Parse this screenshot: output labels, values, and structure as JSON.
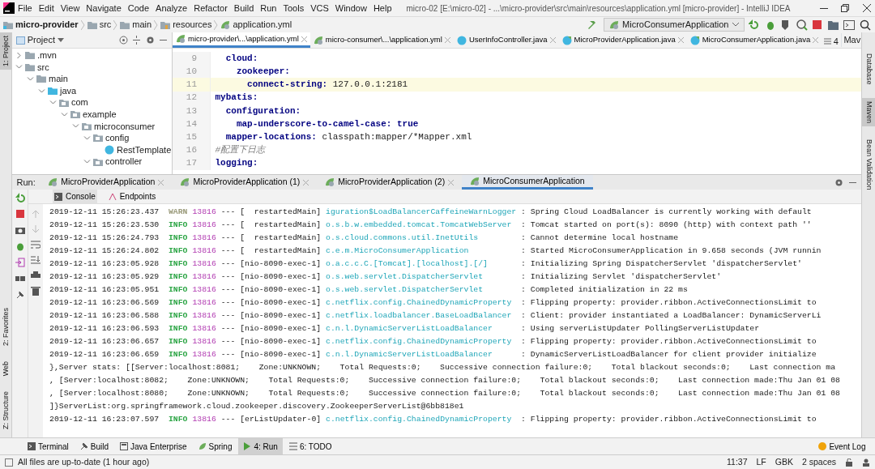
{
  "window": {
    "title": "micro-02 [E:\\micro-02] - ...\\micro-provider\\src\\main\\resources\\application.yml [micro-provider] - IntelliJ IDEA"
  },
  "menu": [
    "File",
    "Edit",
    "View",
    "Navigate",
    "Code",
    "Analyze",
    "Refactor",
    "Build",
    "Run",
    "Tools",
    "VCS",
    "Window",
    "Help"
  ],
  "breadcrumb": [
    {
      "label": "micro-provider",
      "kind": "module"
    },
    {
      "label": "src",
      "kind": "folder"
    },
    {
      "label": "main",
      "kind": "folder"
    },
    {
      "label": "resources",
      "kind": "resources"
    },
    {
      "label": "application.yml",
      "kind": "yaml"
    }
  ],
  "run_config": "MicroConsumerApplication",
  "left_stripe": [
    {
      "label": "1: Project",
      "selected": true
    },
    {
      "label": "2: Favorites",
      "selected": false
    },
    {
      "label": "Web",
      "selected": false
    },
    {
      "label": "Z: Structure",
      "selected": false
    }
  ],
  "right_stripe": [
    {
      "label": "Database",
      "selected": false
    },
    {
      "label": "Maven",
      "selected": true
    },
    {
      "label": "Bean Validation",
      "selected": false
    }
  ],
  "project": {
    "title": "Project",
    "tree": [
      {
        "label": ".mvn",
        "kind": "folder",
        "expanded": false
      },
      {
        "label": "src",
        "kind": "folder",
        "expanded": true,
        "children": [
          {
            "label": "main",
            "kind": "folder",
            "expanded": true,
            "children": [
              {
                "label": "java",
                "kind": "source",
                "expanded": true,
                "children": [
                  {
                    "label": "com",
                    "kind": "package",
                    "expanded": true,
                    "children": [
                      {
                        "label": "example",
                        "kind": "package",
                        "expanded": true,
                        "children": [
                          {
                            "label": "microconsumer",
                            "kind": "package",
                            "expanded": true,
                            "children": [
                              {
                                "label": "config",
                                "kind": "package",
                                "expanded": true,
                                "children": [
                                  {
                                    "label": "RestTemplate",
                                    "kind": "class"
                                  }
                                ]
                              },
                              {
                                "label": "controller",
                                "kind": "package",
                                "expanded": true
                              }
                            ]
                          }
                        ]
                      }
                    ]
                  }
                ]
              }
            ]
          }
        ]
      }
    ]
  },
  "editor_tabs": [
    {
      "label": "micro-provider\\...\\application.yml",
      "kind": "yaml",
      "selected": true
    },
    {
      "label": "micro-consumer\\...\\application.yml",
      "kind": "yaml",
      "selected": false
    },
    {
      "label": "UserInfoController.java",
      "kind": "class",
      "selected": false
    },
    {
      "label": "MicroProviderApplication.java",
      "kind": "app",
      "selected": false
    },
    {
      "label": "MicroConsumerApplication.java",
      "kind": "app",
      "selected": false
    }
  ],
  "editor_overflow": "4",
  "maven_tab": "Mav",
  "code": [
    {
      "no": "9",
      "key": "  cloud:",
      "current": false
    },
    {
      "no": "10",
      "key": "    zookeeper:",
      "current": false
    },
    {
      "no": "11",
      "key": "      connect-string:",
      "value": " 127.0.0.1:2181",
      "current": true
    },
    {
      "no": "12",
      "key": "mybatis:",
      "current": false
    },
    {
      "no": "13",
      "key": "  configuration:",
      "current": false
    },
    {
      "no": "14",
      "key": "    map-underscore-to-camel-case:",
      "value": " true",
      "kind": "bool",
      "current": false
    },
    {
      "no": "15",
      "key": "  mapper-locations:",
      "value": " classpath:mapper/*Mapper.xml",
      "current": false
    },
    {
      "no": "16",
      "comment": "#配置下日志",
      "current": false
    },
    {
      "no": "17",
      "key": "logging:",
      "current": false
    }
  ],
  "run": {
    "label": "Run:",
    "tabs": [
      {
        "label": "MicroProviderApplication",
        "selected": false
      },
      {
        "label": "MicroProviderApplication (1)",
        "selected": false
      },
      {
        "label": "MicroProviderApplication (2)",
        "selected": false
      },
      {
        "label": "MicroConsumerApplication",
        "selected": true
      }
    ],
    "console_tabs": [
      {
        "label": "Console",
        "selected": true
      },
      {
        "label": "Endpoints",
        "selected": false
      }
    ],
    "lines": [
      {
        "kind": "log",
        "time": "2019-12-11 15:26:23.437",
        "level": "WARN",
        "color": "#9a9a7a",
        "pid": "13816",
        "sep": "---",
        "thread": "[  restartedMain]",
        "logger": "iguration$LoadBalancerCaffeineWarnLogger",
        "message": ": Spring Cloud LoadBalancer is currently working with default"
      },
      {
        "kind": "log",
        "time": "2019-12-11 15:26:23.530",
        "level": "INFO",
        "color": "#2ca545",
        "pid": "13816",
        "sep": "---",
        "thread": "[  restartedMain]",
        "logger": "o.s.b.w.embedded.tomcat.TomcatWebServer",
        "message": ": Tomcat started on port(s): 8090 (http) with context path ''"
      },
      {
        "kind": "log",
        "time": "2019-12-11 15:26:24.793",
        "level": "INFO",
        "color": "#2ca545",
        "pid": "13816",
        "sep": "---",
        "thread": "[  restartedMain]",
        "logger": "o.s.cloud.commons.util.InetUtils",
        "message": ": Cannot determine local hostname"
      },
      {
        "kind": "log",
        "time": "2019-12-11 15:26:24.802",
        "level": "INFO",
        "color": "#2ca545",
        "pid": "13816",
        "sep": "---",
        "thread": "[  restartedMain]",
        "logger": "c.e.m.MicroConsumerApplication",
        "message": ": Started MicroConsumerApplication in 9.658 seconds (JVM runnin"
      },
      {
        "kind": "log",
        "time": "2019-12-11 16:23:05.928",
        "level": "INFO",
        "color": "#2ca545",
        "pid": "13816",
        "sep": "---",
        "thread": "[nio-8090-exec-1]",
        "logger": "o.a.c.c.C.[Tomcat].[localhost].[/]",
        "message": ": Initializing Spring DispatcherServlet 'dispatcherServlet'"
      },
      {
        "kind": "log",
        "time": "2019-12-11 16:23:05.929",
        "level": "INFO",
        "color": "#2ca545",
        "pid": "13816",
        "sep": "---",
        "thread": "[nio-8090-exec-1]",
        "logger": "o.s.web.servlet.DispatcherServlet",
        "message": ": Initializing Servlet 'dispatcherServlet'"
      },
      {
        "kind": "log",
        "time": "2019-12-11 16:23:05.951",
        "level": "INFO",
        "color": "#2ca545",
        "pid": "13816",
        "sep": "---",
        "thread": "[nio-8090-exec-1]",
        "logger": "o.s.web.servlet.DispatcherServlet",
        "message": ": Completed initialization in 22 ms"
      },
      {
        "kind": "log",
        "time": "2019-12-11 16:23:06.569",
        "level": "INFO",
        "color": "#2ca545",
        "pid": "13816",
        "sep": "---",
        "thread": "[nio-8090-exec-1]",
        "logger": "c.netflix.config.ChainedDynamicProperty",
        "message": ": Flipping property: provider.ribbon.ActiveConnectionsLimit to"
      },
      {
        "kind": "log",
        "time": "2019-12-11 16:23:06.588",
        "level": "INFO",
        "color": "#2ca545",
        "pid": "13816",
        "sep": "---",
        "thread": "[nio-8090-exec-1]",
        "logger": "c.netflix.loadbalancer.BaseLoadBalancer",
        "message": ": Client: provider instantiated a LoadBalancer: DynamicServerLi"
      },
      {
        "kind": "log",
        "time": "2019-12-11 16:23:06.593",
        "level": "INFO",
        "color": "#2ca545",
        "pid": "13816",
        "sep": "---",
        "thread": "[nio-8090-exec-1]",
        "logger": "c.n.l.DynamicServerListLoadBalancer",
        "message": ": Using serverListUpdater PollingServerListUpdater"
      },
      {
        "kind": "log",
        "time": "2019-12-11 16:23:06.657",
        "level": "INFO",
        "color": "#2ca545",
        "pid": "13816",
        "sep": "---",
        "thread": "[nio-8090-exec-1]",
        "logger": "c.netflix.config.ChainedDynamicProperty",
        "message": ": Flipping property: provider.ribbon.ActiveConnectionsLimit to"
      },
      {
        "kind": "log",
        "time": "2019-12-11 16:23:06.659",
        "level": "INFO",
        "color": "#2ca545",
        "pid": "13816",
        "sep": "---",
        "thread": "[nio-8090-exec-1]",
        "logger": "c.n.l.DynamicServerListLoadBalancer",
        "message": ": DynamicServerListLoadBalancer for client provider initialize"
      },
      {
        "kind": "plain",
        "text": "},Server stats: [[Server:localhost:8081;    Zone:UNKNOWN;    Total Requests:0;    Successive connection failure:0;    Total blackout seconds:0;    Last connection ma"
      },
      {
        "kind": "plain",
        "text": ", [Server:localhost:8082;    Zone:UNKNOWN;    Total Requests:0;    Successive connection failure:0;    Total blackout seconds:0;    Last connection made:Thu Jan 01 08"
      },
      {
        "kind": "plain",
        "text": ", [Server:localhost:8080;    Zone:UNKNOWN;    Total Requests:0;    Successive connection failure:0;    Total blackout seconds:0;    Last connection made:Thu Jan 01 08"
      },
      {
        "kind": "plain",
        "text": "]}ServerList:org.springframework.cloud.zookeeper.discovery.ZookeeperServerList@6bb818e1"
      },
      {
        "kind": "log",
        "time": "2019-12-11 16:23:07.597",
        "level": "INFO",
        "color": "#2ca545",
        "pid": "13816",
        "sep": "---",
        "thread": "[erListUpdater-0]",
        "logger": "c.netflix.config.ChainedDynamicProperty",
        "message": ": Flipping property: provider.ribbon.ActiveConnectionsLimit to"
      }
    ]
  },
  "tool_tabs": [
    {
      "label": "Terminal",
      "kind": "terminal",
      "selected": false
    },
    {
      "label": "Build",
      "kind": "build",
      "selected": false
    },
    {
      "label": "Java Enterprise",
      "kind": "java",
      "selected": false
    },
    {
      "label": "Spring",
      "kind": "spring",
      "selected": false
    },
    {
      "label": "4: Run",
      "kind": "run",
      "selected": true
    },
    {
      "label": "6: TODO",
      "kind": "todo",
      "selected": false
    }
  ],
  "event_log": "Event Log",
  "status_bar": {
    "message": "All files are up-to-date (1 hour ago)",
    "items": [
      "11:37",
      "LF",
      "GBK",
      "2 spaces"
    ]
  }
}
